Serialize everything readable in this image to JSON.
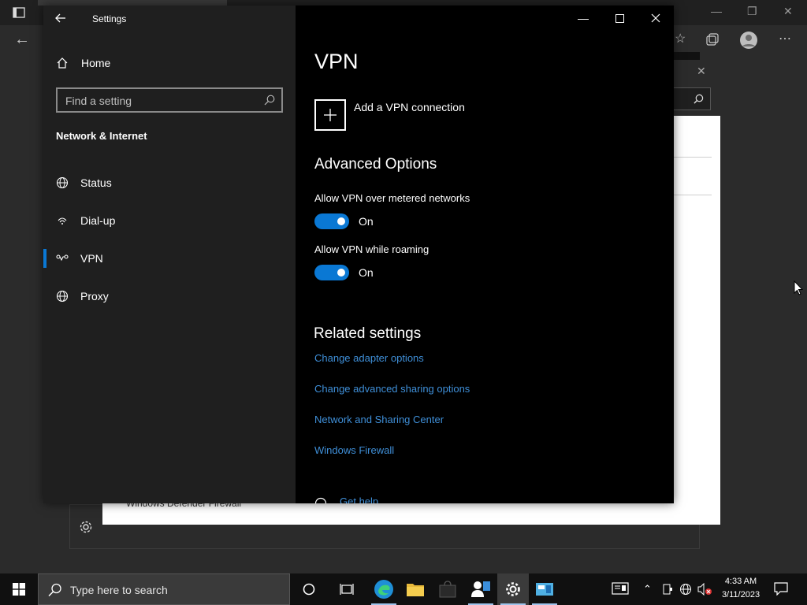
{
  "settings": {
    "app_title": "Settings",
    "home_label": "Home",
    "search_placeholder": "Find a setting",
    "section_title": "Network & Internet",
    "nav": [
      {
        "label": "Status",
        "icon": "globe-status-icon"
      },
      {
        "label": "Dial-up",
        "icon": "dialup-icon"
      },
      {
        "label": "VPN",
        "icon": "vpn-icon",
        "active": true
      },
      {
        "label": "Proxy",
        "icon": "globe-icon"
      }
    ],
    "page_title": "VPN",
    "add_vpn_label": "Add a VPN connection",
    "advanced_title": "Advanced Options",
    "option_metered": {
      "label": "Allow VPN over metered networks",
      "state": "On"
    },
    "option_roaming": {
      "label": "Allow VPN while roaming",
      "state": "On"
    },
    "related_title": "Related settings",
    "links": [
      "Change adapter options",
      "Change advanced sharing options",
      "Network and Sharing Center",
      "Windows Firewall"
    ],
    "get_help": "Get help"
  },
  "background": {
    "firewall_label": "Windows Defender Firewall"
  },
  "taskbar": {
    "search_placeholder": "Type here to search",
    "time": "4:33 AM",
    "date": "3/11/2023"
  },
  "colors": {
    "accent": "#0a78d4",
    "link": "#3f8fd8",
    "sidebar_bg": "#1f1f1f",
    "main_bg": "#000000",
    "taskbar_bg": "#101010"
  }
}
